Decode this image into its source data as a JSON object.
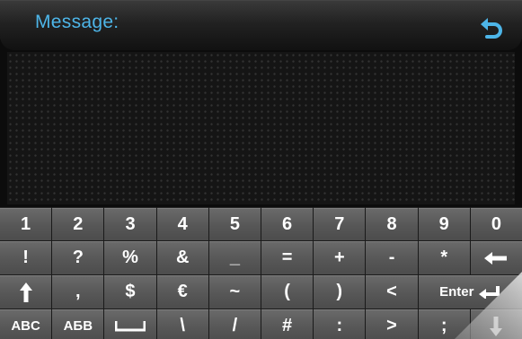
{
  "header": {
    "title": "Message:",
    "back_icon": "return-arrow-icon",
    "accent_color": "#4db5e8"
  },
  "message": {
    "value": ""
  },
  "keyboard": {
    "row1": [
      "1",
      "2",
      "3",
      "4",
      "5",
      "6",
      "7",
      "8",
      "9",
      "0"
    ],
    "row2": [
      "!",
      "?",
      "%",
      "&",
      "_",
      "=",
      "+",
      "-",
      "*"
    ],
    "row2_backspace_icon": "backspace-arrow-icon",
    "row3_shift_icon": "shift-up-arrow-icon",
    "row3": [
      ",",
      "$",
      "€",
      "~",
      "(",
      ")",
      "<"
    ],
    "enter_label": "Enter",
    "enter_icon": "enter-arrow-icon",
    "row4_start": [
      "ABC",
      "АБВ"
    ],
    "space_icon": "space-bar-icon",
    "row4": [
      "\\",
      "/",
      "#",
      ":",
      ">",
      ";"
    ],
    "hide_icon": "down-arrow-icon"
  }
}
